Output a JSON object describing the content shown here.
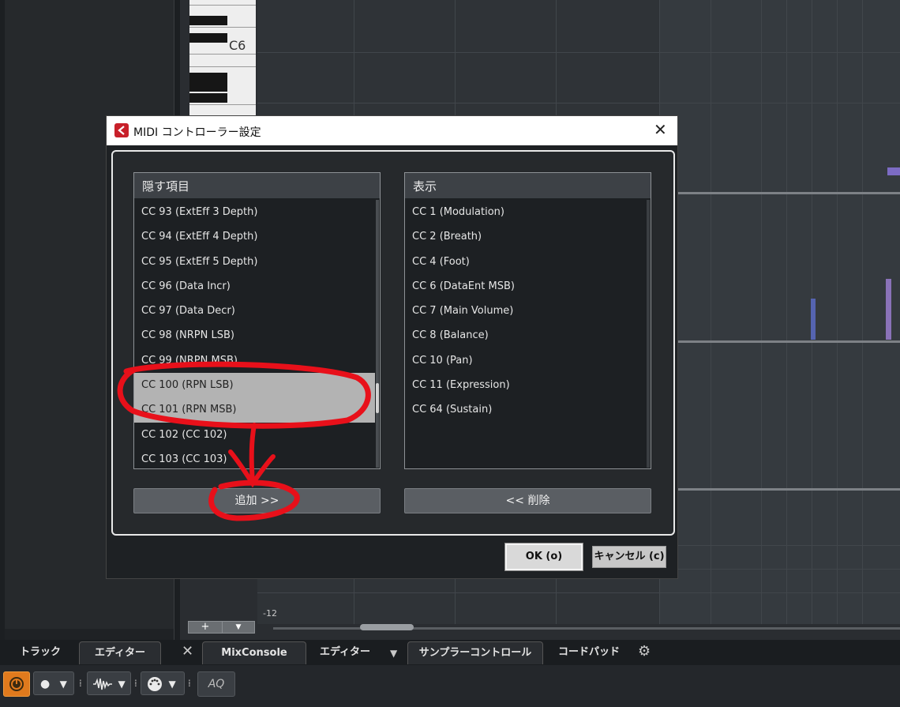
{
  "piano": {
    "octave_label": "C6"
  },
  "lane": {
    "scale_label": "-12"
  },
  "lane_buttons": {
    "add": "+",
    "menu": "▼"
  },
  "tabs": {
    "track": "トラック",
    "editor_left": "エディター",
    "close": "✕",
    "mixconsole": "MixConsole",
    "editor_lower": "エディター",
    "dropdown": "▼",
    "sampler": "サンプラーコントロール",
    "chordpad": "コードパッド",
    "gear": "⚙"
  },
  "toolbar": {
    "record_mode": "●",
    "record_arrow": "▼",
    "wave_arrow": "▼",
    "midi_arrow": "▼",
    "aq": "AQ"
  },
  "dialog": {
    "title": "MIDI コントローラー設定",
    "close": "✕",
    "hidden_header": "隠す項目",
    "shown_header": "表示",
    "hidden_items": [
      "CC 93  (ExtEff 3 Depth)",
      "CC 94  (ExtEff 4 Depth)",
      "CC 95  (ExtEff 5 Depth)",
      "CC 96  (Data Incr)",
      "CC 97  (Data Decr)",
      "CC 98  (NRPN LSB)",
      "CC 99  (NRPN MSB)",
      "CC 100  (RPN LSB)",
      "CC 101  (RPN MSB)",
      "CC 102  (CC 102)",
      "CC 103  (CC 103)"
    ],
    "shown_items": [
      "CC 1  (Modulation)",
      "CC 2  (Breath)",
      "CC 4  (Foot)",
      "CC 6  (DataEnt MSB)",
      "CC 7  (Main Volume)",
      "CC 8  (Balance)",
      "CC 10  (Pan)",
      "CC 11  (Expression)",
      "CC 64  (Sustain)"
    ],
    "add_button": "追加 >>",
    "remove_button": "<< 削除",
    "ok_button": "OK (o)",
    "cancel_button": "キャンセル (c)"
  },
  "colors": {
    "annotation": "#e8101a",
    "note": "#7c6bc4",
    "selection": "#b3b3b3"
  }
}
